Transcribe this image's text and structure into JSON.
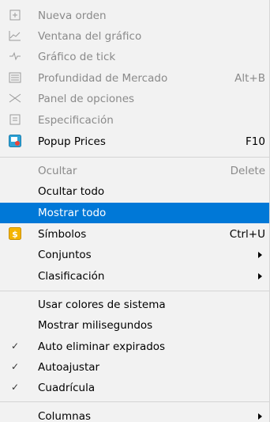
{
  "menu": {
    "items": [
      {
        "label": "Nueva orden",
        "icon": "new-order-icon",
        "disabled": true
      },
      {
        "label": "Ventana del gráfico",
        "icon": "chart-window-icon",
        "disabled": true
      },
      {
        "label": "Gráfico de tick",
        "icon": "tick-chart-icon",
        "disabled": true
      },
      {
        "label": "Profundidad de Mercado",
        "shortcut": "Alt+B",
        "icon": "market-depth-icon",
        "disabled": true
      },
      {
        "label": "Panel de opciones",
        "icon": "options-panel-icon",
        "disabled": true
      },
      {
        "label": "Especificación",
        "icon": "specification-icon",
        "disabled": true
      },
      {
        "label": "Popup Prices",
        "shortcut": "F10",
        "icon": "popup-prices-icon",
        "disabled": false
      },
      {
        "label": "Ocultar",
        "shortcut": "Delete",
        "disabled": true
      },
      {
        "label": "Ocultar todo",
        "disabled": false
      },
      {
        "label": "Mostrar todo",
        "disabled": false,
        "selected": true
      },
      {
        "label": "Símbolos",
        "shortcut": "Ctrl+U",
        "icon": "symbols-icon",
        "disabled": false
      },
      {
        "label": "Conjuntos",
        "submenu": true
      },
      {
        "label": "Clasificación",
        "submenu": true
      },
      {
        "label": "Usar colores de sistema"
      },
      {
        "label": "Mostrar milisegundos"
      },
      {
        "label": "Auto eliminar expirados",
        "checked": true
      },
      {
        "label": "Autoajustar",
        "checked": true
      },
      {
        "label": "Cuadrícula",
        "checked": true
      },
      {
        "label": "Columnas",
        "submenu": true
      }
    ],
    "check_glyph": "✓",
    "colors": {
      "selected_bg": "#0078d7",
      "disabled_text": "#8a8a8a"
    }
  }
}
